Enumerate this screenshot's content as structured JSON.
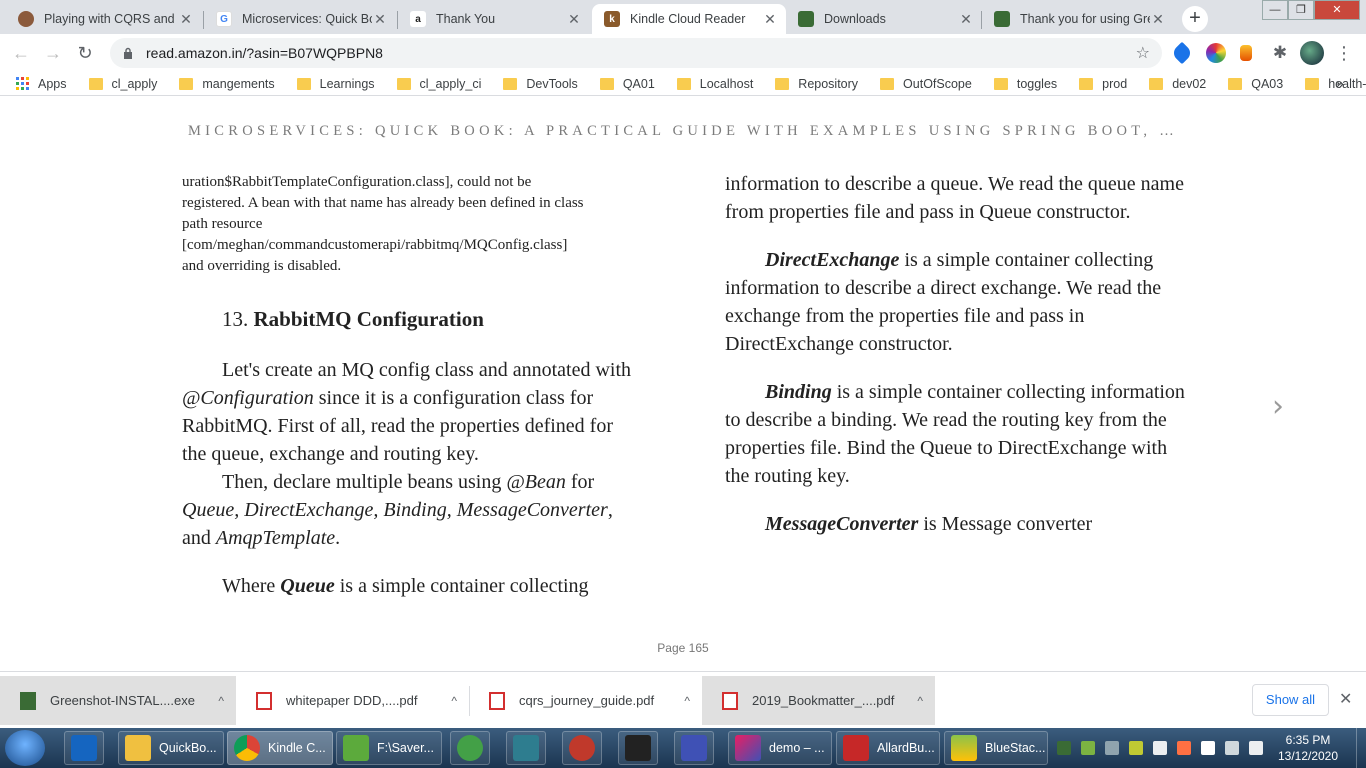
{
  "browser": {
    "tabs": [
      {
        "title": "Playing with CQRS and E",
        "favicon_color": "#8b5a3c"
      },
      {
        "title": "Microservices: Quick Boo",
        "favicon_color": "#4285f4"
      },
      {
        "title": "Thank You",
        "favicon_color": "#222222"
      },
      {
        "title": "Kindle Cloud Reader",
        "favicon_color": "#8a5a2b",
        "active": true
      },
      {
        "title": "Downloads",
        "favicon_color": "#3a6b35"
      },
      {
        "title": "Thank you for using Gre",
        "favicon_color": "#3a6b35"
      }
    ],
    "window_controls": {
      "minimize": "—",
      "maximize": "❐",
      "close": "✕"
    },
    "url": "read.amazon.in/?asin=B07WQPBPN8",
    "bookmarks": [
      "Apps",
      "cl_apply",
      "mangements",
      "Learnings",
      "cl_apply_ci",
      "DevTools",
      "QA01",
      "Localhost",
      "Repository",
      "OutOfScope",
      "toggles",
      "prod",
      "dev02",
      "QA03",
      "health-apis"
    ],
    "bookmarks_overflow": "»"
  },
  "reader": {
    "book_title": "MICROSERVICES: QUICK BOOK: A PRACTICAL GUIDE WITH EXAMPLES USING SPRING BOOT, …",
    "left": {
      "code_lines": [
        "uration$RabbitTemplateConfiguration.class], could not be",
        "registered. A bean with that name has already been defined in class",
        "path resource",
        "[com/meghan/commandcustomerapi/rabbitmq/MQConfig.class]",
        "and overriding is disabled."
      ],
      "heading_num": "13.",
      "heading_text": "RabbitMQ Configuration",
      "p1_a": "Let's create an MQ config class and annotated with ",
      "p1_em": "@Configuration",
      "p1_b": " since it is a configuration class for RabbitMQ. First of all, read the properties defined for the queue, exchange and routing key.",
      "p2_a": "Then, declare multiple beans using ",
      "p2_em1": "@Bean",
      "p2_b": " for ",
      "p2_em2": "Queue, DirectExchange, Binding, MessageConverter",
      "p2_c": ", and ",
      "p2_em3": "AmqpTemplate",
      "p2_d": ".",
      "p3_a": "Where ",
      "p3_bi": "Queue",
      "p3_b": " is a simple container collecting"
    },
    "right": {
      "p1": "information to describe a queue. We read the queue name from properties file and pass in Queue constructor.",
      "p2_bi": "DirectExchange",
      "p2": " is a simple container collecting information to describe a direct exchange. We read the exchange from the properties file and pass in DirectExchange constructor.",
      "p3_bi": "Binding",
      "p3": " is a simple container collecting information to describe a binding. We read the routing key from the properties file. Bind the Queue to DirectExchange with the routing key.",
      "p4_bi": "MessageConverter",
      "p4": " is Message converter"
    },
    "next_arrow": "›",
    "page": "Page 165"
  },
  "downloads": {
    "items": [
      {
        "name": "Greenshot-INSTAL....exe",
        "icon_color": "#3a6b35"
      },
      {
        "name": "whitepaper DDD,....pdf",
        "icon_color": "#d32f2f"
      },
      {
        "name": "cqrs_journey_guide.pdf",
        "icon_color": "#d32f2f"
      },
      {
        "name": "2019_Bookmatter_....pdf",
        "icon_color": "#d32f2f"
      }
    ],
    "chevron": "^",
    "show_all": "Show all",
    "close": "✕"
  },
  "taskbar": {
    "tasks": [
      {
        "label": "",
        "color": "#1565c0"
      },
      {
        "label": "QuickBo...",
        "color": "#f0c040"
      },
      {
        "label": "Kindle C...",
        "color": "#db4437"
      },
      {
        "label": "F:\\Saver...",
        "color": "#5caa3c"
      },
      {
        "label": "",
        "color": "#43a047"
      },
      {
        "label": "",
        "color": "#2e7d8f"
      },
      {
        "label": "",
        "color": "#c0392b"
      },
      {
        "label": "",
        "color": "#222222"
      },
      {
        "label": "",
        "color": "#3f51b5"
      },
      {
        "label": "demo – ...",
        "color": "#e91e63"
      },
      {
        "label": "AllardBu...",
        "color": "#c62828"
      },
      {
        "label": "BlueStac...",
        "color": "#8bc34a"
      }
    ],
    "time": "6:35 PM",
    "date": "13/12/2020"
  }
}
